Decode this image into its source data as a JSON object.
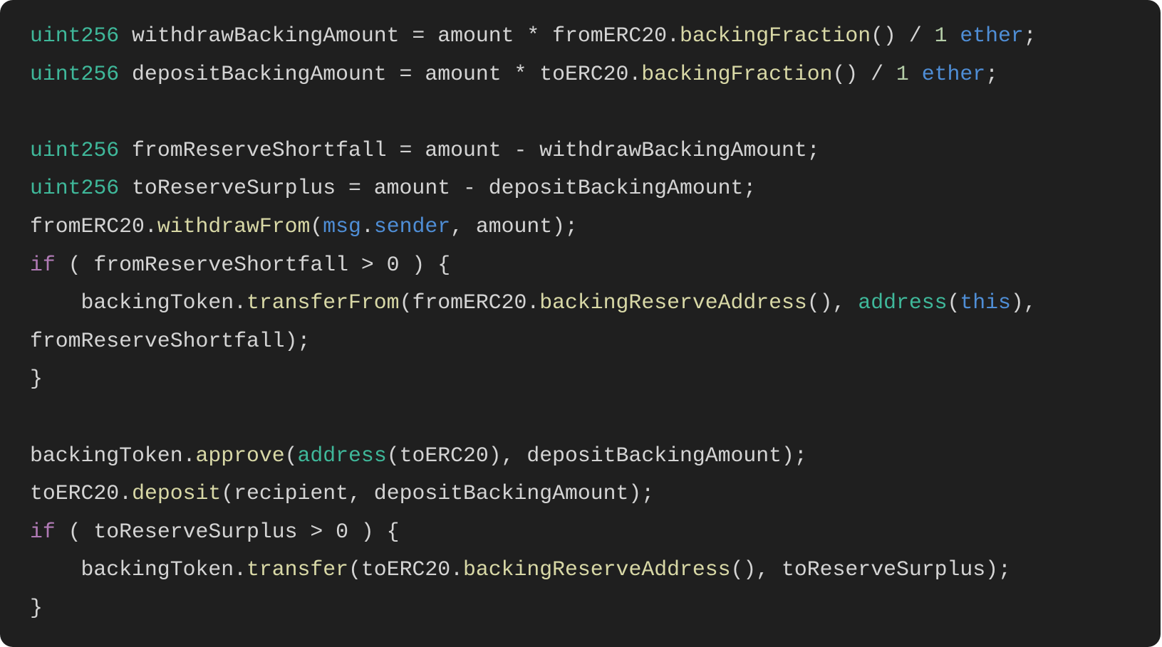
{
  "code": {
    "language": "solidity",
    "colors": {
      "background": "#1f1f1f",
      "plain": "#d4d4d4",
      "type": "#3fb89a",
      "function": "#d8d8a6",
      "number": "#b5cea8",
      "keyword_blue": "#4f8ed6",
      "keyword_control": "#b07ab5"
    },
    "lines": [
      [
        [
          "type",
          "uint256"
        ],
        [
          "plain",
          " withdrawBackingAmount = amount * fromERC20."
        ],
        [
          "fn",
          "backingFraction"
        ],
        [
          "plain",
          "() / "
        ],
        [
          "num",
          "1"
        ],
        [
          "plain",
          " "
        ],
        [
          "kwb",
          "ether"
        ],
        [
          "plain",
          ";"
        ]
      ],
      [
        [
          "type",
          "uint256"
        ],
        [
          "plain",
          " depositBackingAmount = amount * toERC20."
        ],
        [
          "fn",
          "backingFraction"
        ],
        [
          "plain",
          "() / "
        ],
        [
          "num",
          "1"
        ],
        [
          "plain",
          " "
        ],
        [
          "kwb",
          "ether"
        ],
        [
          "plain",
          ";"
        ]
      ],
      [],
      [
        [
          "type",
          "uint256"
        ],
        [
          "plain",
          " fromReserveShortfall = amount - withdrawBackingAmount;"
        ]
      ],
      [
        [
          "type",
          "uint256"
        ],
        [
          "plain",
          " toReserveSurplus = amount - depositBackingAmount;"
        ]
      ],
      [
        [
          "plain",
          "fromERC20."
        ],
        [
          "fn",
          "withdrawFrom"
        ],
        [
          "plain",
          "("
        ],
        [
          "kwb",
          "msg"
        ],
        [
          "plain",
          "."
        ],
        [
          "kwb",
          "sender"
        ],
        [
          "plain",
          ", amount);"
        ]
      ],
      [
        [
          "kwc",
          "if"
        ],
        [
          "plain",
          " ( fromReserveShortfall > 0 ) {"
        ]
      ],
      [
        [
          "plain",
          "    backingToken."
        ],
        [
          "fn",
          "transferFrom"
        ],
        [
          "plain",
          "(fromERC20."
        ],
        [
          "fn",
          "backingReserveAddress"
        ],
        [
          "plain",
          "(), "
        ],
        [
          "type",
          "address"
        ],
        [
          "plain",
          "("
        ],
        [
          "kwb",
          "this"
        ],
        [
          "plain",
          "),"
        ]
      ],
      [
        [
          "plain",
          "fromReserveShortfall);"
        ]
      ],
      [
        [
          "plain",
          "}"
        ]
      ],
      [],
      [
        [
          "plain",
          "backingToken."
        ],
        [
          "fn",
          "approve"
        ],
        [
          "plain",
          "("
        ],
        [
          "type",
          "address"
        ],
        [
          "plain",
          "(toERC20), depositBackingAmount);"
        ]
      ],
      [
        [
          "plain",
          "toERC20."
        ],
        [
          "fn",
          "deposit"
        ],
        [
          "plain",
          "(recipient, depositBackingAmount);"
        ]
      ],
      [
        [
          "kwc",
          "if"
        ],
        [
          "plain",
          " ( toReserveSurplus > 0 ) {"
        ]
      ],
      [
        [
          "plain",
          "    backingToken."
        ],
        [
          "fn",
          "transfer"
        ],
        [
          "plain",
          "(toERC20."
        ],
        [
          "fn",
          "backingReserveAddress"
        ],
        [
          "plain",
          "(), toReserveSurplus);"
        ]
      ],
      [
        [
          "plain",
          "}"
        ]
      ]
    ]
  }
}
